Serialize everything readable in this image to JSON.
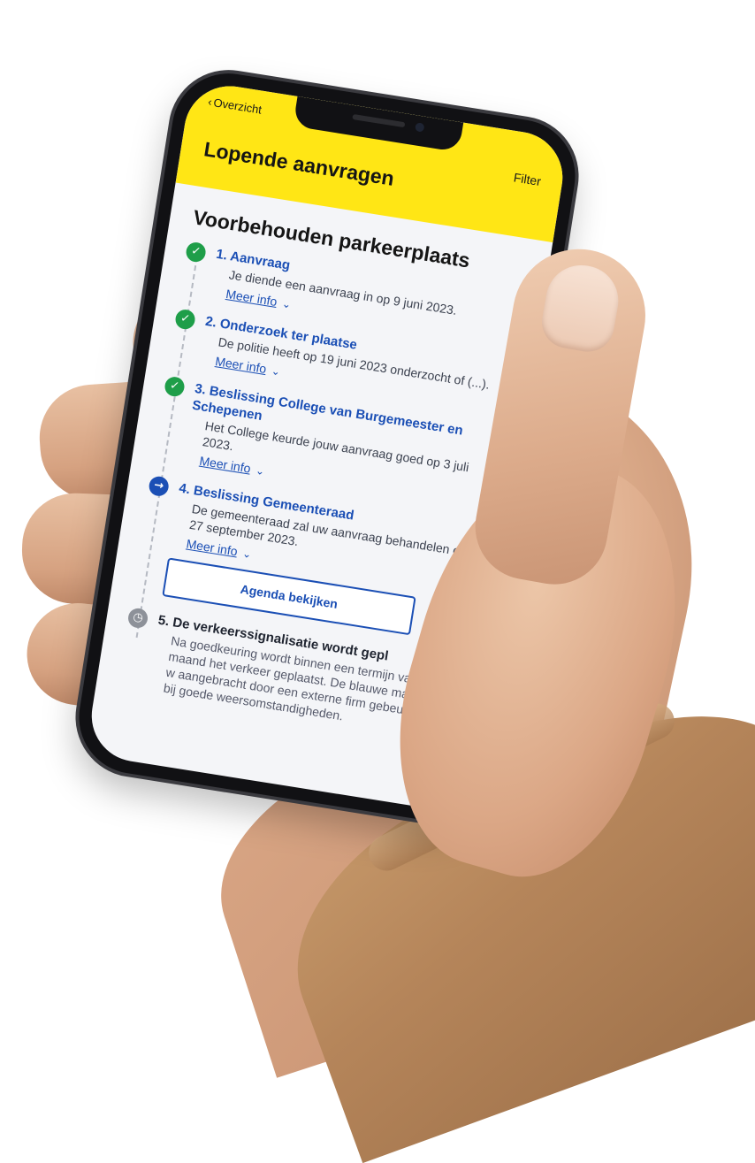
{
  "header": {
    "back_label": "Overzicht",
    "title": "Lopende aanvragen",
    "filter_label": "Filter"
  },
  "section": {
    "title": "Voorbehouden parkeerplaats"
  },
  "steps": [
    {
      "status": "done",
      "title": "1. Aanvraag",
      "description": "Je diende een aanvraag in op 9 juni 2023.",
      "more_label": "Meer info"
    },
    {
      "status": "done",
      "title": "2. Onderzoek ter plaatse",
      "description": "De politie heeft op 19 juni 2023 onderzocht of (...).",
      "more_label": "Meer info"
    },
    {
      "status": "done",
      "title": "3. Beslissing College van Burgemeester en Schepenen",
      "description": "Het College keurde jouw aanvraag goed op 3 juli 2023.",
      "more_label": "Meer info"
    },
    {
      "status": "active",
      "title": "4. Beslissing Gemeenteraad",
      "description": "De gemeenteraad zal uw aanvraag behandelen op 27 september 2023.",
      "more_label": "Meer info",
      "button_label": "Agenda bekijken"
    },
    {
      "status": "pending",
      "title": "5. De verkeerssignalisatie wordt gepl",
      "description": "Na goedkeuring wordt binnen een termijn van één maand het verkeer geplaatst. De blauwe markering w aangebracht door een externe firm gebeurt enkel bij goede weersomstandigheden."
    }
  ],
  "icons": {
    "done": "checkmark-icon",
    "active": "arrow-right-icon",
    "pending": "clock-icon",
    "more": "chevron-down-icon",
    "back": "chevron-left-icon"
  },
  "colors": {
    "header_yellow": "#ffe615",
    "link_blue": "#1b4fb5",
    "done_green": "#1e9e49",
    "pending_grey": "#8d9199"
  }
}
